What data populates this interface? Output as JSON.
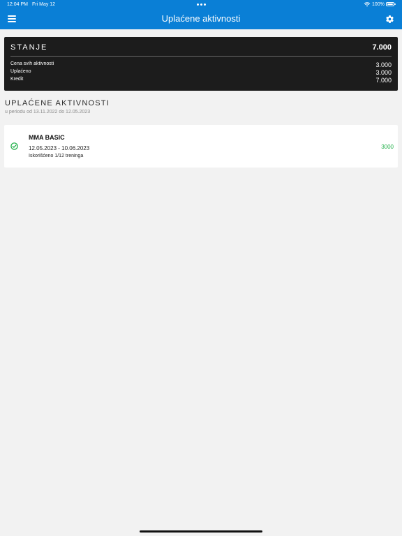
{
  "status_bar": {
    "time": "12:04 PM",
    "date": "Fri May 12",
    "battery": "100%"
  },
  "header": {
    "title": "Uplaćene aktivnosti",
    "background_color": "#0a7fd6",
    "menu_icon": "hamburger-menu-icon",
    "settings_icon": "gear-icon"
  },
  "balance": {
    "title": "STANJE",
    "total": "7.000",
    "rows": [
      {
        "label": "Cena svih aktivnosti",
        "value": "3.000"
      },
      {
        "label": "Uplaćeno",
        "value": "3.000"
      },
      {
        "label": "Kredit",
        "value": "7.000"
      }
    ]
  },
  "section": {
    "title": "UPLAĆENE AKTIVNOSTI",
    "subtitle": "u periodu od 13.11.2022 do 12.05.2023"
  },
  "activities": [
    {
      "name": "MMA BASIC",
      "dates": "12.05.2023 - 10.06.2023",
      "usage": "Iskorišćeno 1/12 treninga",
      "amount": "3000",
      "status_icon": "check-circle-icon",
      "status_color": "#22b04a"
    }
  ]
}
